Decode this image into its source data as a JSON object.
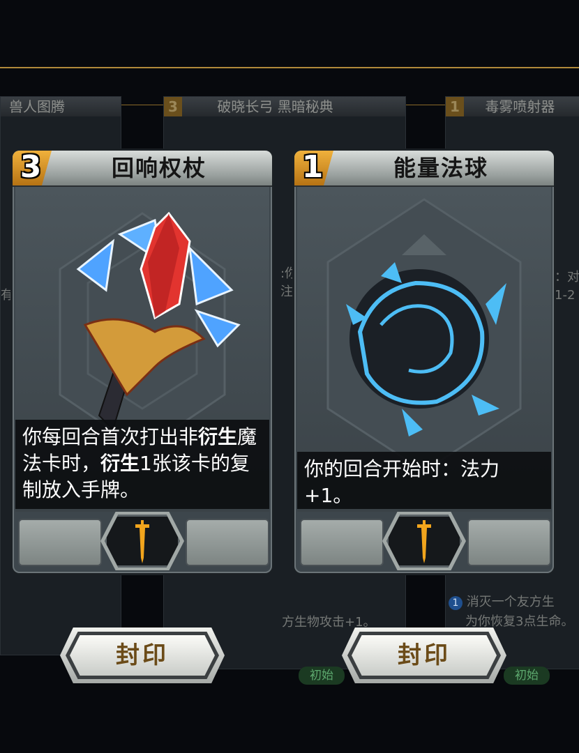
{
  "background_cards": [
    {
      "cost": "",
      "name": "兽人图腾"
    },
    {
      "cost": "3",
      "name": "破晓长弓 黑暗秘典"
    },
    {
      "cost": "1",
      "name": "毒雾喷射器"
    }
  ],
  "background_texts": {
    "left_mid_1": "有",
    "mid_1": ":你",
    "mid_2": "注",
    "right_1": "：对",
    "right_2": "1-2",
    "lower_mid": "方生物攻击+1。",
    "lower_right_1": "消灭一个友方生",
    "lower_right_2": "为你恢复3点生命。",
    "lower_right_icon": "1",
    "badge_1": "初始",
    "badge_2": "初始"
  },
  "cards": [
    {
      "cost": "3",
      "name": "回响权杖",
      "description_parts": [
        "你每回合首次打出非",
        "衍生",
        "魔法卡时，",
        "衍生",
        "1张该卡的复制放入手牌。"
      ],
      "art_icon": "scepter-crystal-icon",
      "footer_icon": "sword-icon",
      "seal_label": "封印"
    },
    {
      "cost": "1",
      "name": "能量法球",
      "description_parts": [
        "你的回合开始时：法力+1。"
      ],
      "art_icon": "energy-orb-icon",
      "footer_icon": "sword-icon",
      "seal_label": "封印"
    }
  ],
  "colors": {
    "gold": "#b08a3a",
    "sword": "#f2a51d",
    "card_bg": "#3d464c"
  }
}
